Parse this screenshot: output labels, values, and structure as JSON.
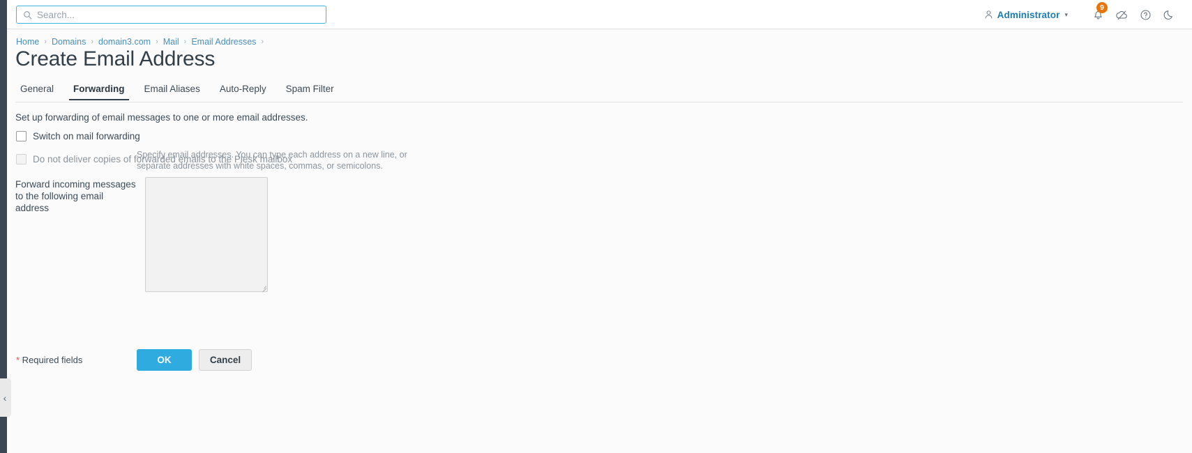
{
  "header": {
    "search": {
      "placeholder": "Search...",
      "value": "",
      "icon": "search-icon"
    },
    "user": {
      "name": "Administrator",
      "icon": "user-icon",
      "caret": "chevron-down-icon"
    },
    "icons": [
      {
        "name": "bell-icon",
        "badge": "9",
        "badge_color": "#e8740c"
      },
      {
        "name": "cloud-slash-icon"
      },
      {
        "name": "help-circle-icon"
      },
      {
        "name": "moon-icon"
      }
    ]
  },
  "breadcrumb": {
    "items": [
      {
        "label": "Home"
      },
      {
        "label": "Domains"
      },
      {
        "label": "domain3.com"
      },
      {
        "label": "Mail"
      },
      {
        "label": "Email Addresses"
      }
    ],
    "separator": "›",
    "trailing_separator": "›"
  },
  "page": {
    "title": "Create Email Address"
  },
  "tabs": [
    {
      "label": "General",
      "active": false
    },
    {
      "label": "Forwarding",
      "active": true
    },
    {
      "label": "Email Aliases",
      "active": false
    },
    {
      "label": "Auto-Reply",
      "active": false
    },
    {
      "label": "Spam Filter",
      "active": false
    }
  ],
  "form": {
    "intro": "Set up forwarding of email messages to one or more email addresses.",
    "checkbox_forwarding": {
      "label": "Switch on mail forwarding",
      "checked": false,
      "disabled": false
    },
    "checkbox_no_copies": {
      "label": "Do not deliver copies of forwarded emails to the Plesk mailbox",
      "checked": false,
      "disabled": true
    },
    "forward_field": {
      "label": "Forward incoming messages to the following email address",
      "value": "",
      "placeholder": "",
      "disabled": true,
      "hint": "Specify email addresses. You can type each address on a new line, or separate addresses with white spaces, commas, or semicolons."
    }
  },
  "footer": {
    "required_star": "*",
    "required_text": " Required fields",
    "ok_label": "OK",
    "cancel_label": "Cancel"
  },
  "sidebar": {
    "collapse_icon": "‹"
  },
  "colors": {
    "accent_blue": "#2fabdf",
    "link_blue": "#4a90b8",
    "badge_orange": "#e8740c",
    "rail_dark": "#3b4754",
    "required_red": "#d9534f"
  }
}
